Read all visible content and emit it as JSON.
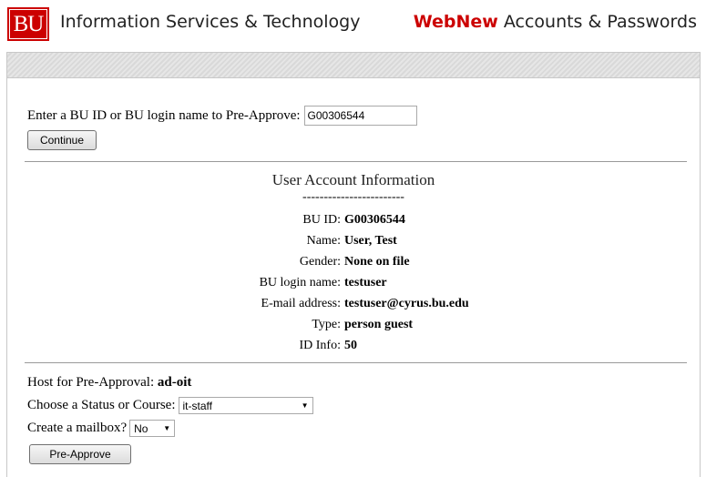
{
  "header": {
    "logo_text": "BU",
    "org_title": "Information Services & Technology",
    "app_brand": "WebNew",
    "app_section": "Accounts & Passwords",
    "brand_color": "#cc0000"
  },
  "lookup": {
    "prompt": "Enter a BU ID or BU login name to Pre-Approve:",
    "input_value": "G00306544",
    "continue_label": "Continue"
  },
  "account_info": {
    "title": "User Account Information",
    "divider": "------------------------",
    "fields": [
      {
        "label": "BU ID:",
        "value": "G00306544"
      },
      {
        "label": "Name:",
        "value": "User, Test"
      },
      {
        "label": "Gender:",
        "value": "None on file"
      },
      {
        "label": "BU login name:",
        "value": "testuser"
      },
      {
        "label": "E-mail address:",
        "value": "testuser@cyrus.bu.edu"
      },
      {
        "label": "Type:",
        "value": "person guest"
      },
      {
        "label": "ID Info:",
        "value": "50"
      }
    ]
  },
  "preapproval": {
    "host_label": "Host for Pre-Approval:",
    "host_value": "ad-oit",
    "status_label": "Choose a Status or Course:",
    "status_selected": "it-staff",
    "mailbox_label": "Create a mailbox?",
    "mailbox_selected": "No",
    "submit_label": "Pre-Approve"
  }
}
